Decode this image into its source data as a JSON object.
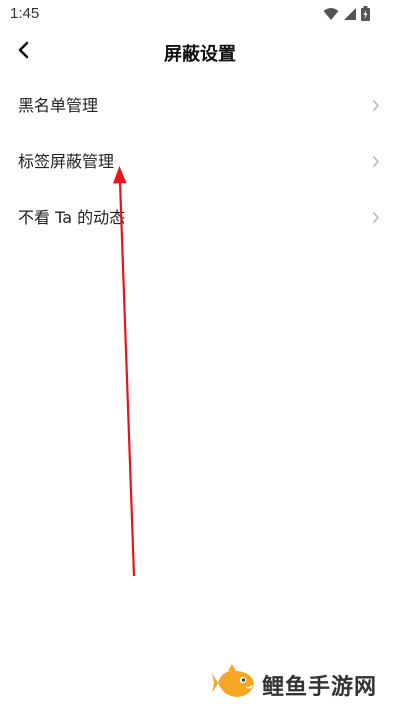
{
  "status_bar": {
    "time": "1:45",
    "icons": [
      "wifi-icon",
      "signal-icon",
      "battery-icon"
    ]
  },
  "header": {
    "back_icon": "chevron-left-icon",
    "title": "屏蔽设置"
  },
  "menu": {
    "items": [
      {
        "label": "黑名单管理",
        "icon": "chevron-right-icon"
      },
      {
        "label": "标签屏蔽管理",
        "icon": "chevron-right-icon"
      },
      {
        "label": "不看 Ta 的动态",
        "icon": "chevron-right-icon"
      }
    ]
  },
  "annotation": {
    "color": "#e8141c"
  },
  "watermark": {
    "logo_icon": "fish-logo-icon",
    "text": "鲤鱼手游网",
    "color": "#f5a623"
  },
  "colors": {
    "chevron": "#b5b5b5",
    "text": "#222222",
    "background": "#ffffff"
  }
}
